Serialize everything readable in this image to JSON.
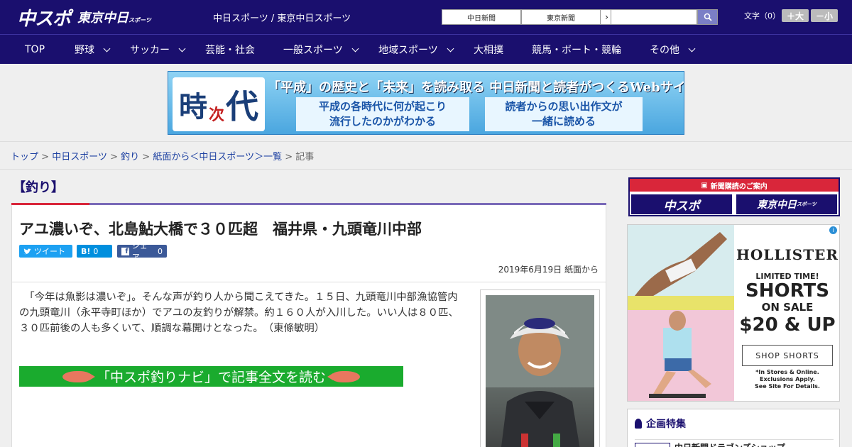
{
  "header": {
    "logo_chuspo": "中スポ",
    "logo_tokyo": "東京中日",
    "logo_tokyo_sub": "スポーツ",
    "site_links": "中日スポーツ / 東京中日スポーツ",
    "chunichi_button": "中日新聞",
    "tokyo_button": "東京新聞",
    "button_arrow": "›",
    "search_placeholder": "",
    "fontsize_label": "文字（0）",
    "font_larger": "＋大",
    "font_smaller": "－小"
  },
  "nav": {
    "items": [
      {
        "label": "TOP",
        "has_dropdown": false
      },
      {
        "label": "野球",
        "has_dropdown": true
      },
      {
        "label": "サッカー",
        "has_dropdown": true
      },
      {
        "label": "芸能・社会",
        "has_dropdown": false
      },
      {
        "label": "一般スポーツ",
        "has_dropdown": true
      },
      {
        "label": "地域スポーツ",
        "has_dropdown": true
      },
      {
        "label": "大相撲",
        "has_dropdown": false
      },
      {
        "label": "競馬・ボート・競輪",
        "has_dropdown": false
      },
      {
        "label": "その他",
        "has_dropdown": true
      }
    ]
  },
  "banner": {
    "kanji_1": "時",
    "kanji_2": "次",
    "kanji_3": "代",
    "headline": "「平成」の歴史と「未来」を読み取る 中日新聞と読者がつくるWebサイト",
    "box_left": "平成の各時代に何が起こり\n流行したのかがわかる",
    "box_right": "読者からの思い出作文が\n一緒に読める"
  },
  "breadcrumb": {
    "items": [
      "トップ",
      "中日スポーツ",
      "釣り",
      "紙面から＜中日スポーツ＞一覧"
    ],
    "current": "記事",
    "separator": ">"
  },
  "category": "【釣り】",
  "article": {
    "title": "アユ濃いぞ、北島鮎大橋で３０匹超　福井県・九頭竜川中部",
    "share_tweet": "ツイート",
    "share_hatena": "B!",
    "share_hatena_count": "0",
    "share_facebook": "シェア",
    "share_facebook_count": "0",
    "date": "2019年6月19日 紙面から",
    "body": "　「今年は魚影は濃いぞ」。そんな声が釣り人から聞こえてきた。１５日、九頭竜川中部漁協管内の九頭竜川（永平寺町ほか）でアユの友釣りが解禁。約１６０人が入川した。いい人は８０匹、３０匹前後の人も多くいて、順調な幕開けとなった。　（東條敏明）",
    "navi_link": "「中スポ釣りナビ」で記事全文を読む"
  },
  "sidebar": {
    "subscribe_header": "新聞購読のご案内",
    "subscribe_chuspo": "中スポ",
    "subscribe_tokyo": "東京中日",
    "subscribe_tokyo_sub": "スポーツ",
    "ad": {
      "brand": "HOLLISTER",
      "limited": "LIMITED TIME!",
      "shorts": "SHORTS",
      "on_sale": "ON SALE",
      "price": "$20 & UP",
      "cta": "SHOP SHORTS",
      "fine_1": "*In Stores & Online.",
      "fine_2": "Exclusions Apply.",
      "fine_3": "See Site For Details.",
      "info": "i"
    },
    "special_title": "企画特集",
    "special_item": "中日新聞ドラゴンズショップ"
  },
  "colors": {
    "brand_navy": "#1a0f6e",
    "accent_red": "#d9263a",
    "navi_green": "#1aab2e",
    "twitter": "#1da1f2",
    "hatena": "#008fde",
    "facebook": "#3b5998"
  }
}
